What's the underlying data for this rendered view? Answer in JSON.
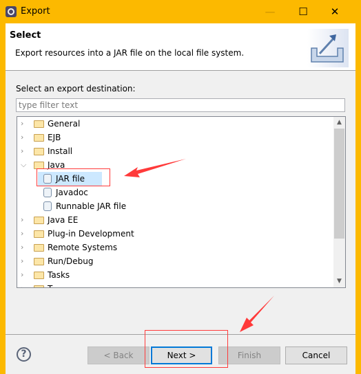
{
  "window": {
    "title": "Export",
    "controls": {
      "minimize": "—",
      "maximize": "☐",
      "close": "✕"
    }
  },
  "header": {
    "title": "Select",
    "description": "Export resources into a JAR file on the local file system."
  },
  "body": {
    "label": "Select an export destination:",
    "filter": {
      "value": "",
      "placeholder": "type filter text"
    }
  },
  "tree": {
    "items": [
      {
        "label": "General",
        "type": "folder",
        "expanded": false
      },
      {
        "label": "EJB",
        "type": "folder",
        "expanded": false
      },
      {
        "label": "Install",
        "type": "folder",
        "expanded": false
      },
      {
        "label": "Java",
        "type": "folder",
        "expanded": true
      },
      {
        "label": "JAR file",
        "type": "leaf",
        "selected": true
      },
      {
        "label": "Javadoc",
        "type": "leaf"
      },
      {
        "label": "Runnable JAR file",
        "type": "leaf"
      },
      {
        "label": "Java EE",
        "type": "folder",
        "expanded": false
      },
      {
        "label": "Plug-in Development",
        "type": "folder",
        "expanded": false
      },
      {
        "label": "Remote Systems",
        "type": "folder",
        "expanded": false
      },
      {
        "label": "Run/Debug",
        "type": "folder",
        "expanded": false
      },
      {
        "label": "Tasks",
        "type": "folder",
        "expanded": false
      },
      {
        "label": "T",
        "type": "folder",
        "expanded": false
      }
    ]
  },
  "buttons": {
    "help": "?",
    "back": "< Back",
    "next": "Next >",
    "finish": "Finish",
    "cancel": "Cancel"
  },
  "colors": {
    "titlebar": "#fcb900",
    "selection": "#cce8ff",
    "focus": "#0078d7",
    "annotation": "#ff3a3a"
  }
}
